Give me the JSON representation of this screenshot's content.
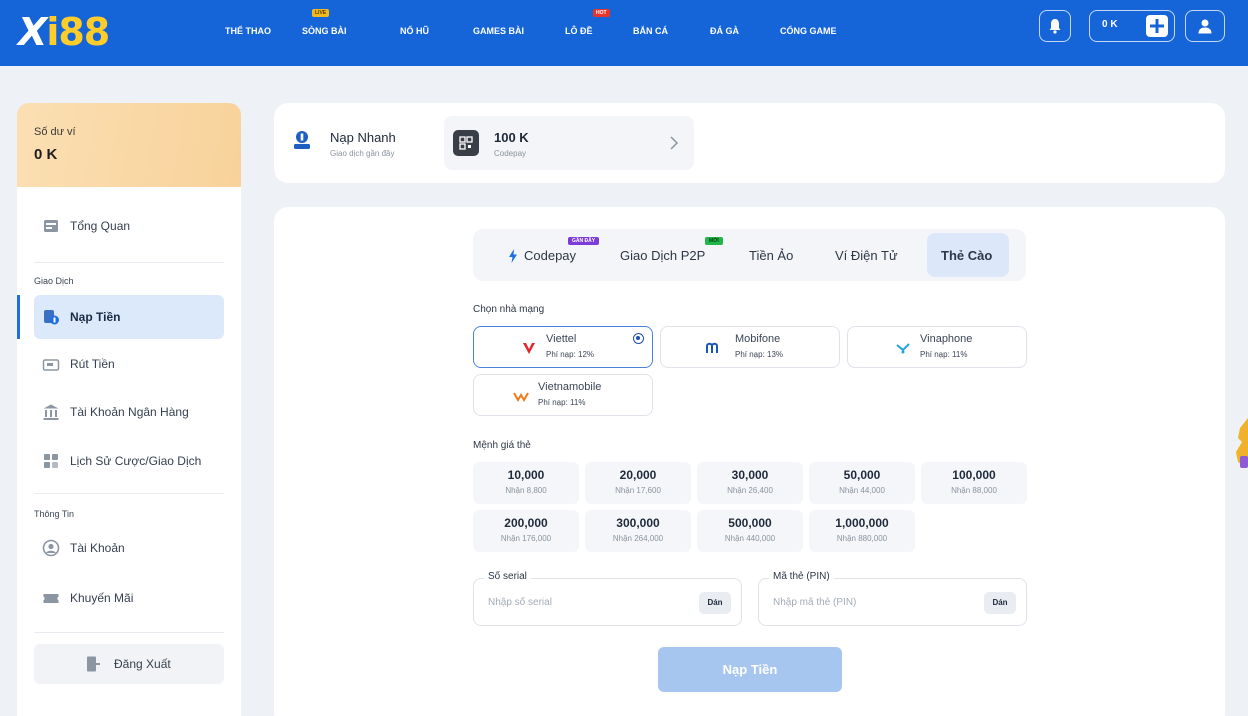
{
  "header": {
    "logo": {
      "x": "X",
      "rest": "i88"
    },
    "nav": [
      {
        "label": "THỂ THAO"
      },
      {
        "label": "SÒNG BÀI",
        "badge": "LIVE"
      },
      {
        "label": "NỔ HŨ"
      },
      {
        "label": "GAMES BÀI"
      },
      {
        "label": "LÔ ĐỀ",
        "badge": "HOT"
      },
      {
        "label": "BẮN CÁ"
      },
      {
        "label": "ĐÁ GÀ"
      },
      {
        "label": "CỔNG GAME"
      }
    ],
    "wallet_amount": "0 K",
    "icons": {
      "bell": "bell-icon",
      "plus": "plus-icon",
      "user": "user-icon"
    }
  },
  "sidebar": {
    "balance_label": "Số dư ví",
    "balance_value": "0 K",
    "overview": "Tổng Quan",
    "section_transactions": "Giao Dịch",
    "deposit": "Nạp Tiền",
    "withdraw": "Rút Tiền",
    "bank_account": "Tài Khoản Ngân Hàng",
    "history": "Lịch Sử Cược/Giao Dịch",
    "section_info": "Thông Tin",
    "account": "Tài Khoản",
    "promotions": "Khuyến Mãi",
    "logout": "Đăng Xuất"
  },
  "quick": {
    "title": "Nạp Nhanh",
    "subtitle": "Giao dịch gần đây",
    "recent_amount": "100 K",
    "recent_method": "Codepay"
  },
  "tabs": [
    {
      "label": "Codepay",
      "badge": "GẦN ĐÂY"
    },
    {
      "label": "Giao Dịch P2P",
      "badge": "MỚI"
    },
    {
      "label": "Tiền Ảo"
    },
    {
      "label": "Ví Điện Tử"
    },
    {
      "label": "Thẻ Cào",
      "active": true
    }
  ],
  "network_label": "Chọn nhà mạng",
  "networks": [
    {
      "name": "Viettel",
      "fee": "Phí nạp: 12%",
      "selected": true
    },
    {
      "name": "Mobifone",
      "fee": "Phí nạp: 13%"
    },
    {
      "name": "Vinaphone",
      "fee": "Phí nạp: 11%"
    },
    {
      "name": "Vietnamobile",
      "fee": "Phí nạp: 11%"
    }
  ],
  "denomination_label": "Mệnh giá thẻ",
  "denominations": [
    {
      "value": "10,000",
      "receive": "Nhận 8,800"
    },
    {
      "value": "20,000",
      "receive": "Nhận 17,600"
    },
    {
      "value": "30,000",
      "receive": "Nhận 26,400"
    },
    {
      "value": "50,000",
      "receive": "Nhận 44,000"
    },
    {
      "value": "100,000",
      "receive": "Nhận 88,000"
    },
    {
      "value": "200,000",
      "receive": "Nhận 176,000"
    },
    {
      "value": "300,000",
      "receive": "Nhận 264,000"
    },
    {
      "value": "500,000",
      "receive": "Nhận 440,000"
    },
    {
      "value": "1,000,000",
      "receive": "Nhận 880,000"
    }
  ],
  "serial": {
    "label": "Số serial",
    "placeholder": "Nhập số serial",
    "paste": "Dán"
  },
  "pin": {
    "label": "Mã thẻ (PIN)",
    "placeholder": "Nhập mã thẻ (PIN)",
    "paste": "Dán"
  },
  "submit": "Nạp Tiền",
  "colors": {
    "header": "#1665d8",
    "accent": "#1e6fe0",
    "gold": "#ffcd2a",
    "submit_disabled": "#a6c6ef"
  }
}
